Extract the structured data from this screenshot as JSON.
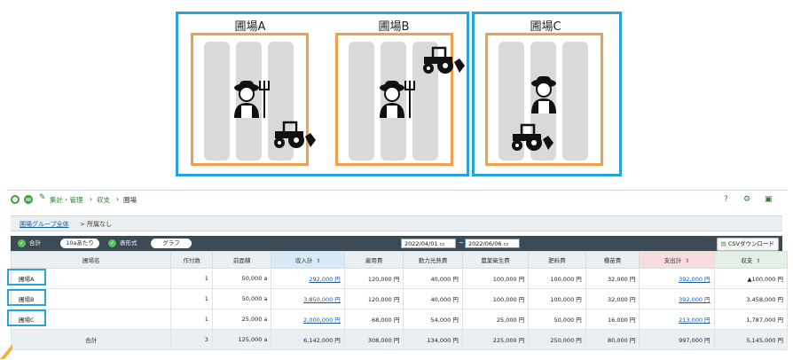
{
  "diagram": {
    "fields": [
      {
        "name": "圃場A"
      },
      {
        "name": "圃場B"
      },
      {
        "name": "圃場C"
      }
    ]
  },
  "app": {
    "breadcrumb": [
      "集計・管理",
      "収支",
      "圃場"
    ],
    "subbar": {
      "link": "圃場グループ全体",
      "separator": ">",
      "current": "所属なし"
    },
    "toolbar": {
      "total_label": "合計",
      "per_area_label": "10aあたり",
      "display_label": "表形式",
      "graph_label": "グラフ",
      "date_from": "2022/04/01",
      "date_sep": "~",
      "date_to": "2022/06/06",
      "csv_label": "CSVダウンロード"
    },
    "table": {
      "headers": [
        "圃場名",
        "作付数",
        "前面積",
        "収入計",
        "雇用費",
        "動力光熱費",
        "農薬衛生費",
        "肥料費",
        "種苗費",
        "支出計",
        "収支"
      ],
      "rows": [
        {
          "name": "圃場A",
          "count": "1",
          "area": "50,000 a",
          "income": "292,000 円",
          "employ": "120,000 円",
          "power": "40,000 円",
          "pest": "100,000 円",
          "fert": "100,000 円",
          "seed": "32,000 円",
          "expense": "392,000 円",
          "balance": "▲100,000 円"
        },
        {
          "name": "圃場B",
          "count": "1",
          "area": "50,000 a",
          "income": "3,850,000 円",
          "employ": "120,000 円",
          "power": "40,000 円",
          "pest": "100,000 円",
          "fert": "100,000 円",
          "seed": "32,000 円",
          "expense": "392,000 円",
          "balance": "3,458,000 円"
        },
        {
          "name": "圃場C",
          "count": "1",
          "area": "25,000 a",
          "income": "2,000,000 円",
          "employ": "68,000 円",
          "power": "54,000 円",
          "pest": "25,000 円",
          "fert": "50,000 円",
          "seed": "16,000 円",
          "expense": "213,000 円",
          "balance": "1,787,000 円"
        }
      ],
      "total": {
        "name": "合計",
        "count": "3",
        "area": "125,000 a",
        "income": "6,142,000 円",
        "employ": "308,000 円",
        "power": "134,000 円",
        "pest": "225,000 円",
        "fert": "250,000 円",
        "seed": "80,000 円",
        "expense": "997,000 円",
        "balance": "5,145,000 円"
      }
    }
  },
  "colors": {
    "group_border": "#2aa3db",
    "field_border": "#f0a04b",
    "toolbar": "#3c4a55",
    "accent_green": "#5bbf5a"
  }
}
